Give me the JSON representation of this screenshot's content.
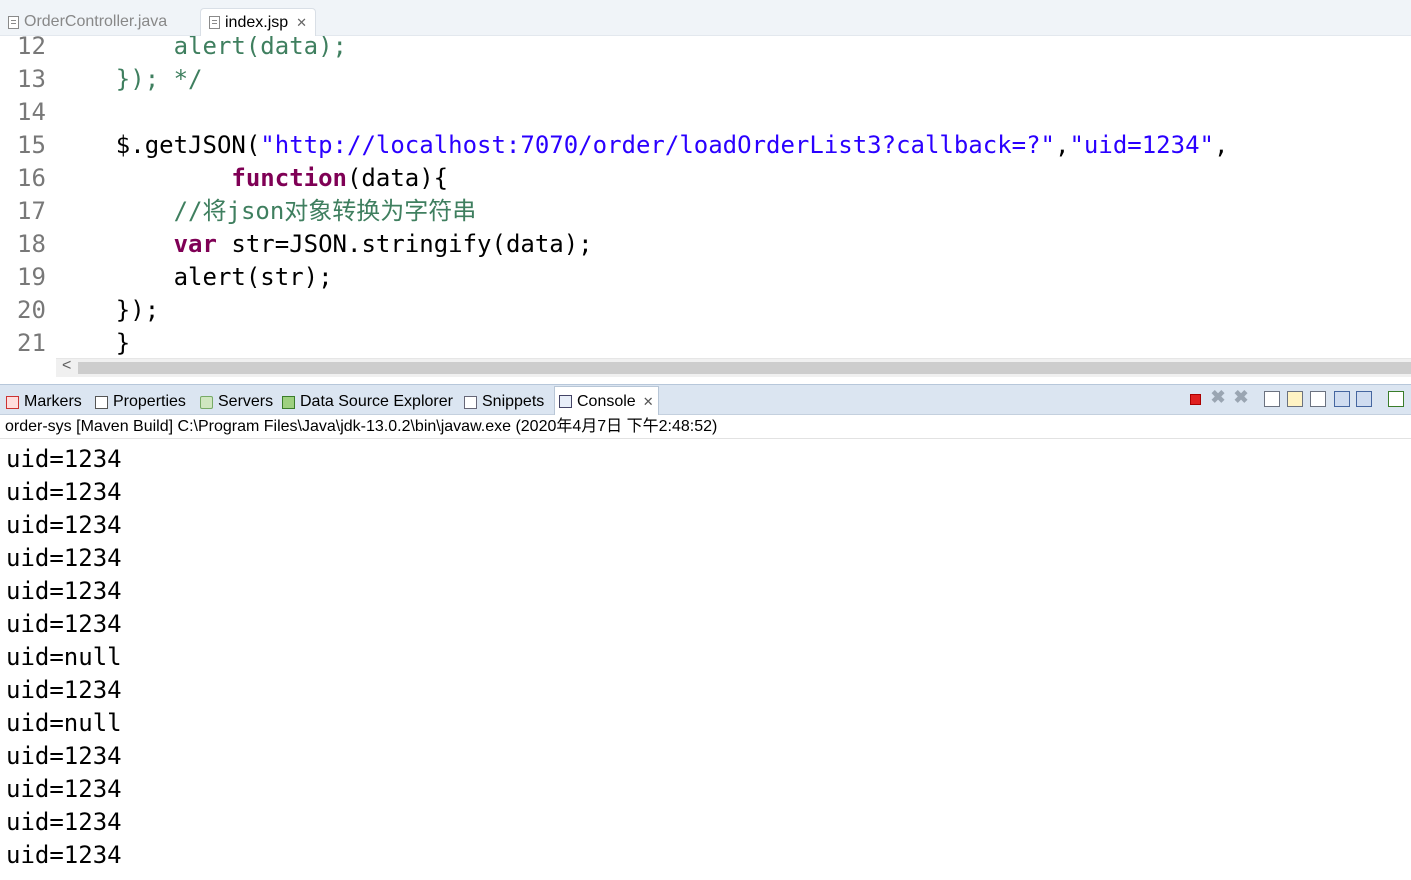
{
  "editor_tabs": [
    {
      "label": "OrderController.java",
      "active": false
    },
    {
      "label": "index.jsp",
      "active": true
    }
  ],
  "code_lines": [
    {
      "num": "12",
      "indent": "        ",
      "segs": [
        {
          "t": "alert(data);",
          "c": "green"
        }
      ]
    },
    {
      "num": "13",
      "indent": "    ",
      "segs": [
        {
          "t": "}); */",
          "c": "green"
        }
      ]
    },
    {
      "num": "14",
      "indent": "",
      "segs": []
    },
    {
      "num": "15",
      "indent": "    ",
      "segs": [
        {
          "t": "$.getJSON(",
          "c": "plain"
        },
        {
          "t": "\"http://localhost:7070/order/loadOrderList3?callback=?\"",
          "c": "blue"
        },
        {
          "t": ",",
          "c": "plain"
        },
        {
          "t": "\"uid=1234\"",
          "c": "blue"
        },
        {
          "t": ",",
          "c": "plain"
        }
      ]
    },
    {
      "num": "16",
      "indent": "            ",
      "segs": [
        {
          "t": "function",
          "c": "kw"
        },
        {
          "t": "(data){",
          "c": "plain"
        }
      ]
    },
    {
      "num": "17",
      "indent": "        ",
      "segs": [
        {
          "t": "//将json对象转换为字符串",
          "c": "green"
        }
      ]
    },
    {
      "num": "18",
      "indent": "        ",
      "segs": [
        {
          "t": "var",
          "c": "kw"
        },
        {
          "t": " str=JSON.stringify(data);",
          "c": "plain"
        }
      ]
    },
    {
      "num": "19",
      "indent": "        ",
      "segs": [
        {
          "t": "alert(str);",
          "c": "plain"
        }
      ]
    },
    {
      "num": "20",
      "indent": "    ",
      "segs": [
        {
          "t": "});",
          "c": "plain"
        }
      ]
    },
    {
      "num": "21",
      "indent": "    ",
      "segs": [
        {
          "t": "}",
          "c": "plain"
        }
      ]
    }
  ],
  "scrollbar": {
    "left_arrow": "<"
  },
  "view_tabs": [
    {
      "label": "Markers",
      "icon": "markers-icon"
    },
    {
      "label": "Properties",
      "icon": "properties-icon"
    },
    {
      "label": "Servers",
      "icon": "servers-icon"
    },
    {
      "label": "Data Source Explorer",
      "icon": "data-source-explorer-icon"
    },
    {
      "label": "Snippets",
      "icon": "snippets-icon"
    },
    {
      "label": "Console",
      "icon": "console-icon",
      "selected": true
    }
  ],
  "console": {
    "status": "order-sys [Maven Build] C:\\Program Files\\Java\\jdk-13.0.2\\bin\\javaw.exe (2020年4月7日 下午2:48:52)",
    "output": [
      "uid=1234",
      "uid=1234",
      "uid=1234",
      "uid=1234",
      "uid=1234",
      "uid=1234",
      "uid=null",
      "uid=1234",
      "uid=null",
      "uid=1234",
      "uid=1234",
      "uid=1234",
      "uid=1234"
    ]
  },
  "colors": {
    "comment": "#3f7f5f",
    "string": "#2a00ff",
    "keyword": "#7f0055",
    "line_number": "#787878",
    "view_tab_bar": "#dbe5f1"
  }
}
